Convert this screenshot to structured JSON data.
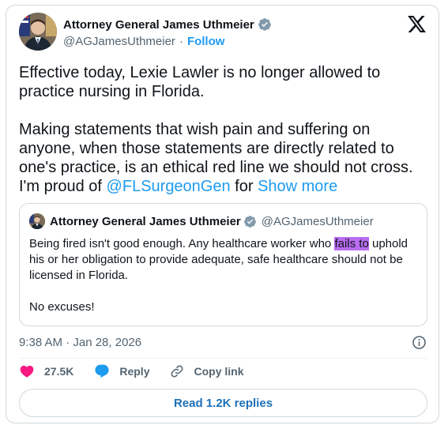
{
  "author": {
    "name": "Attorney General James Uthmeier",
    "handle": "@AGJamesUthmeier",
    "separator": "·",
    "follow_label": "Follow"
  },
  "tweet": {
    "para1": "Effective today, Lexie Lawler is no longer allowed to practice nursing in Florida.",
    "para2_text": "Making statements that wish pain and suffering on anyone, when those statements are directly related to one's practice, is an ethical red line we should not cross. I'm proud of ",
    "mention": "@FLSurgeonGen",
    "para2_tail": " for ",
    "show_more": "Show more"
  },
  "quote": {
    "name": "Attorney General James Uthmeier",
    "handle": "@AGJamesUthmeier",
    "text_before": "Being fired isn't good enough. Any healthcare worker who ",
    "highlight": "fails to",
    "text_after": " uphold his or her obligation to provide adequate, safe healthcare should not be licensed in Florida.",
    "text2": "No excuses!"
  },
  "timestamp": "9:38 AM · Jan 28, 2026",
  "actions": {
    "likes": "27.5K",
    "reply": "Reply",
    "copy_link": "Copy link"
  },
  "read_replies": "Read 1.2K replies",
  "colors": {
    "link": "#1d9bf0",
    "verified": "#829aab",
    "like": "#f91880",
    "highlight": "#b96cf2"
  },
  "icons": [
    "x-logo-icon",
    "verified-badge-icon",
    "info-icon",
    "heart-icon",
    "reply-icon",
    "link-icon"
  ]
}
